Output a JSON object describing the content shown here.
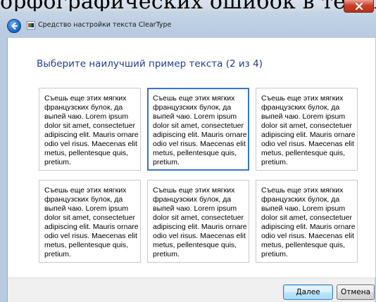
{
  "background_window": {
    "visible_text": "орфографических ошибок в тексте."
  },
  "window": {
    "title": "Средство настройки текста ClearType",
    "back_icon": "back-arrow-icon",
    "app_icon": "cleartype-app-icon",
    "close_icon": "close-icon"
  },
  "main": {
    "heading": "Выберите наилучший пример текста (2 из 4)",
    "samples": [
      {
        "text": "Съешь еще этих мягких французских булок, да выпей чаю. Lorem ipsum dolor sit amet, consectetuer adipiscing elit. Mauris ornare odio vel risus. Maecenas elit metus, pellentesque quis, pretium.",
        "selected": false
      },
      {
        "text": "Съешь еще этих мягких французских булок, да выпей чаю. Lorem ipsum dolor sit amet, consectetuer adipiscing elit. Mauris ornare odio vel risus. Maecenas elit metus, pellentesque quis, pretium.",
        "selected": true
      },
      {
        "text": "Съешь еще этих мягких французских булок, да выпей чаю. Lorem ipsum dolor sit amet, consectetuer adipiscing elit. Mauris ornare odio vel risus. Maecenas elit metus, pellentesque quis, pretium.",
        "selected": false
      },
      {
        "text": "Съешь еще этих мягких французских булок, да выпей чаю. Lorem ipsum dolor sit amet, consectetuer adipiscing elit. Mauris ornare odio vel risus. Maecenas elit metus, pellentesque quis, pretium.",
        "selected": false
      },
      {
        "text": "Съешь еще этих мягких французских булок, да выпей чаю. Lorem ipsum dolor sit amet, consectetuer adipiscing elit. Mauris ornare odio vel risus. Maecenas elit metus, pellentesque quis, pretium.",
        "selected": false
      },
      {
        "text": "Съешь еще этих мягких французских булок, да выпей чаю. Lorem ipsum dolor sit amet, consectetuer adipiscing elit. Mauris ornare odio vel risus. Maecenas elit metus, pellentesque quis, pretium.",
        "selected": false
      }
    ]
  },
  "footer": {
    "next_label": "Далее",
    "cancel_label": "Отмена"
  },
  "colors": {
    "heading": "#1e3f8e",
    "selection_border": "#3b74c8",
    "close_button": "#c8402a"
  }
}
